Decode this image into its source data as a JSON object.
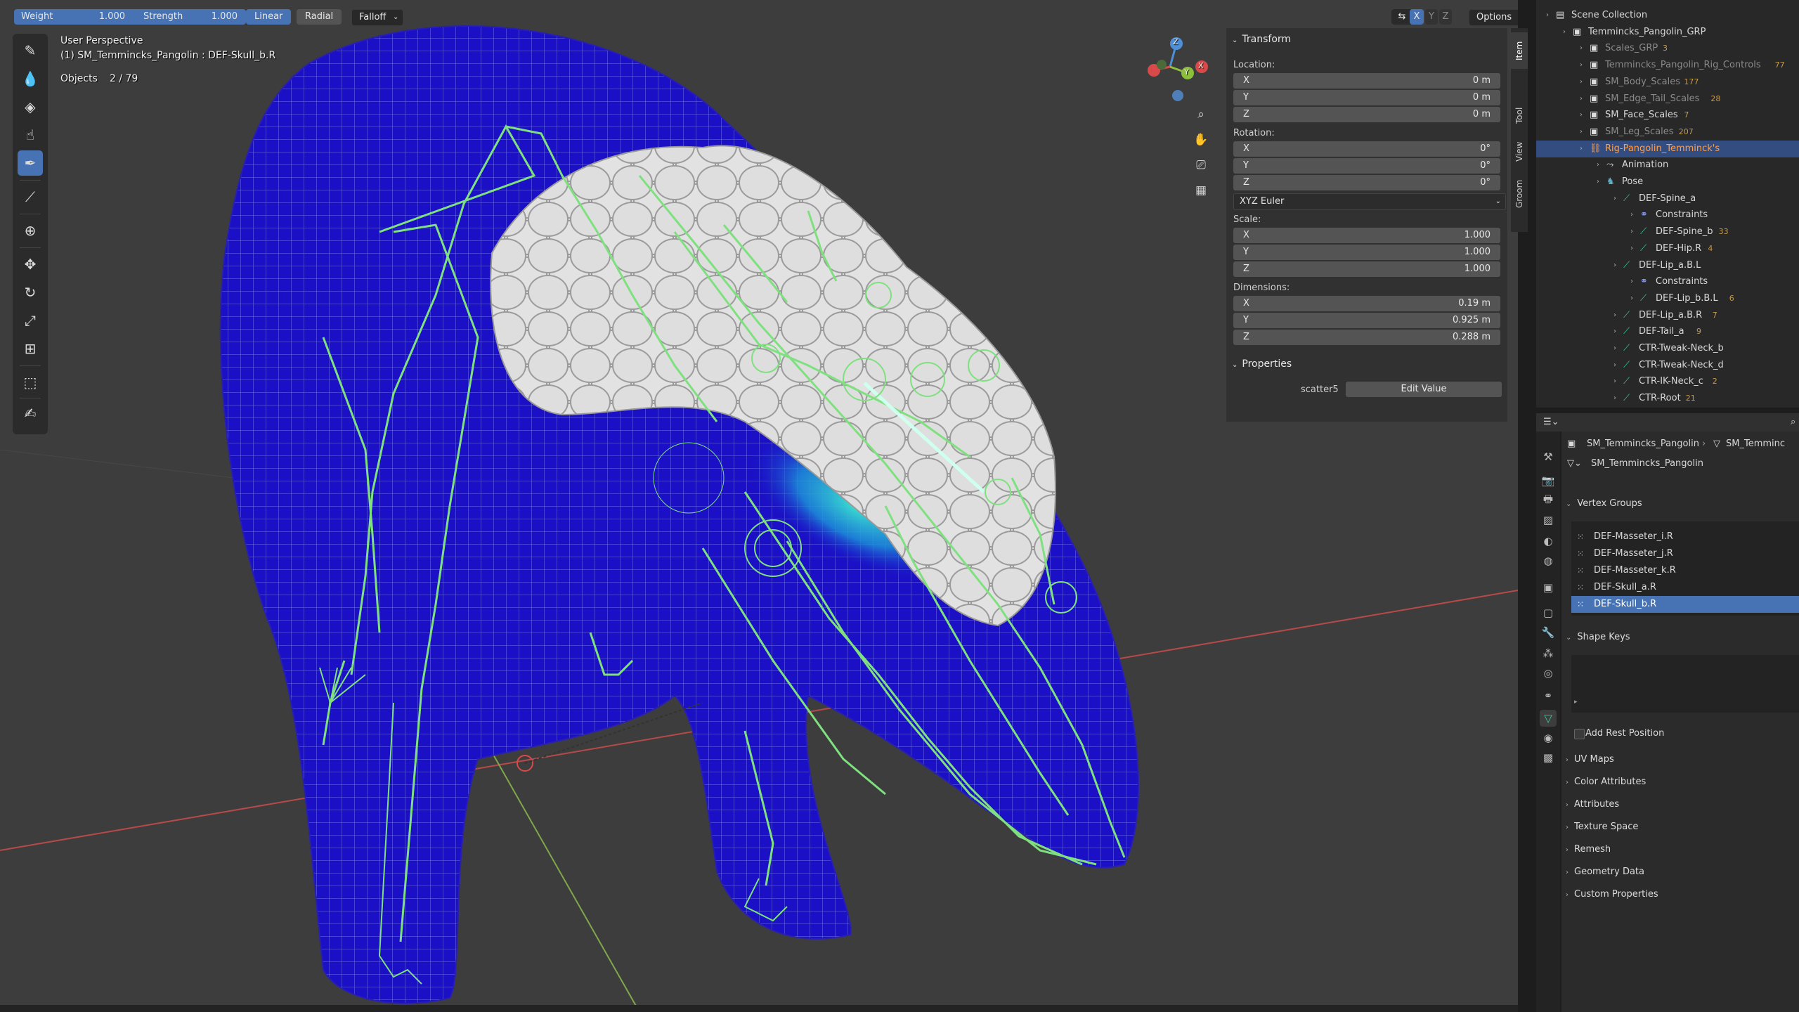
{
  "tool_header": {
    "weight_label": "Weight",
    "weight_value": "1.000",
    "strength_label": "Strength",
    "strength_value": "1.000",
    "falloff_shape_linear": "Linear",
    "falloff_shape_radial": "Radial",
    "falloff_label": "Falloff",
    "options_label": "Options",
    "axis_x": "X",
    "axis_y": "Y",
    "axis_z": "Z"
  },
  "viewport": {
    "perspective_label": "User Perspective",
    "active_object": "(1) SM_Temmincks_Pangolin : DEF-Skull_b.R",
    "objects_label": "Objects",
    "objects_count": "2 / 79",
    "gizmo_axes": {
      "x": "X",
      "y": "Y",
      "z": "Z"
    }
  },
  "toolbar": {
    "tools": [
      "draw-brush",
      "blur-brush",
      "average-brush",
      "smear-brush",
      "weight-brush",
      "sample-weight",
      "cursor",
      "move",
      "rotate",
      "scale",
      "transform",
      "select-box",
      "annotate"
    ],
    "active_tool": "weight-brush"
  },
  "npanel": {
    "transform_title": "Transform",
    "location_label": "Location:",
    "location": [
      {
        "axis": "X",
        "value": "0 m"
      },
      {
        "axis": "Y",
        "value": "0 m"
      },
      {
        "axis": "Z",
        "value": "0 m"
      }
    ],
    "rotation_label": "Rotation:",
    "rotation": [
      {
        "axis": "X",
        "value": "0°"
      },
      {
        "axis": "Y",
        "value": "0°"
      },
      {
        "axis": "Z",
        "value": "0°"
      }
    ],
    "rotation_mode": "XYZ Euler",
    "scale_label": "Scale:",
    "scale": [
      {
        "axis": "X",
        "value": "1.000"
      },
      {
        "axis": "Y",
        "value": "1.000"
      },
      {
        "axis": "Z",
        "value": "1.000"
      }
    ],
    "dimensions_label": "Dimensions:",
    "dimensions": [
      {
        "axis": "X",
        "value": "0.19 m"
      },
      {
        "axis": "Y",
        "value": "0.925 m"
      },
      {
        "axis": "Z",
        "value": "0.288 m"
      }
    ],
    "properties_title": "Properties",
    "prop_name": "scatter5",
    "prop_button": "Edit Value",
    "tabs": [
      "Item",
      "Tool",
      "View",
      "Groom"
    ]
  },
  "outliner": {
    "rows": [
      {
        "label": "Scene Collection",
        "icon": "scene-collection-icon",
        "indent": 0,
        "style": "normal"
      },
      {
        "label": "Temmincks_Pangolin_GRP",
        "icon": "collection-icon",
        "indent": 1,
        "style": "normal"
      },
      {
        "label": "Scales_GRP",
        "icon": "collection-icon",
        "indent": 2,
        "style": "dim",
        "badge": "3"
      },
      {
        "label": "Temmincks_Pangolin_Rig_Controls",
        "icon": "collection-icon",
        "indent": 2,
        "style": "dim",
        "badge": "77"
      },
      {
        "label": "SM_Body_Scales",
        "icon": "collection-icon",
        "indent": 2,
        "style": "dim",
        "badge": "177"
      },
      {
        "label": "SM_Edge_Tail_Scales",
        "icon": "collection-icon",
        "indent": 2,
        "style": "dim",
        "badge": "28"
      },
      {
        "label": "SM_Face_Scales",
        "icon": "collection-icon",
        "indent": 2,
        "style": "normal",
        "badge": "7"
      },
      {
        "label": "SM_Leg_Scales",
        "icon": "collection-icon",
        "indent": 2,
        "style": "dim",
        "badge": "207"
      },
      {
        "label": "Rig-Pangolin_Temminck's",
        "icon": "armature-icon",
        "indent": 2,
        "style": "orange"
      },
      {
        "label": "Animation",
        "icon": "animation-icon",
        "indent": 3,
        "style": "normal"
      },
      {
        "label": "Pose",
        "icon": "pose-icon",
        "indent": 3,
        "style": "normal"
      },
      {
        "label": "DEF-Spine_a",
        "icon": "bone-icon",
        "indent": 4,
        "style": "normal"
      },
      {
        "label": "Constraints",
        "icon": "constraint-icon",
        "indent": 5,
        "style": "normal"
      },
      {
        "label": "DEF-Spine_b",
        "icon": "bone-icon",
        "indent": 5,
        "style": "normal",
        "badge": "33"
      },
      {
        "label": "DEF-Hip.R",
        "icon": "bone-icon",
        "indent": 5,
        "style": "normal",
        "badge": "4"
      },
      {
        "label": "DEF-Lip_a.B.L",
        "icon": "bone-icon",
        "indent": 4,
        "style": "normal"
      },
      {
        "label": "Constraints",
        "icon": "constraint-icon",
        "indent": 5,
        "style": "normal"
      },
      {
        "label": "DEF-Lip_b.B.L",
        "icon": "bone-icon",
        "indent": 5,
        "style": "normal",
        "badge": "6"
      },
      {
        "label": "DEF-Lip_a.B.R",
        "icon": "bone-icon",
        "indent": 4,
        "style": "normal",
        "badge": "7"
      },
      {
        "label": "DEF-Tail_a",
        "icon": "bone-icon",
        "indent": 4,
        "style": "normal",
        "badge": "9"
      },
      {
        "label": "CTR-Tweak-Neck_b",
        "icon": "bone-icon",
        "indent": 4,
        "style": "normal"
      },
      {
        "label": "CTR-Tweak-Neck_d",
        "icon": "bone-icon",
        "indent": 4,
        "style": "normal"
      },
      {
        "label": "CTR-IK-Neck_c",
        "icon": "bone-icon",
        "indent": 4,
        "style": "normal",
        "badge": "2"
      },
      {
        "label": "CTR-Root",
        "icon": "bone-icon",
        "indent": 4,
        "style": "normal",
        "badge": "21"
      }
    ]
  },
  "properties": {
    "breadcrumb_object": "SM_Temmincks_Pangolin",
    "breadcrumb_data": "SM_Temminc",
    "mesh_name": "SM_Temmincks_Pangolin",
    "vertex_groups_title": "Vertex Groups",
    "vertex_groups": [
      "DEF-Masseter_i.R",
      "DEF-Masseter_j.R",
      "DEF-Masseter_k.R",
      "DEF-Skull_a.R",
      "DEF-Skull_b.R"
    ],
    "selected_vertex_group": "DEF-Skull_b.R",
    "shape_keys_title": "Shape Keys",
    "add_rest_position": "Add Rest Position",
    "sections": [
      "UV Maps",
      "Color Attributes",
      "Attributes",
      "Texture Space",
      "Remesh",
      "Geometry Data",
      "Custom Properties"
    ],
    "tabs": [
      "tool",
      "render",
      "output",
      "view-layer",
      "scene",
      "world",
      "collection",
      "object",
      "modifiers",
      "particles",
      "physics",
      "constraints",
      "data",
      "material",
      "texture"
    ]
  },
  "colors": {
    "accent": "#4772b3",
    "viewport_bg": "#3d3d3d",
    "mesh_blue": "#1a0fc4",
    "bone_green": "#7fe07f",
    "armature_orange": "#ff9f4a"
  }
}
